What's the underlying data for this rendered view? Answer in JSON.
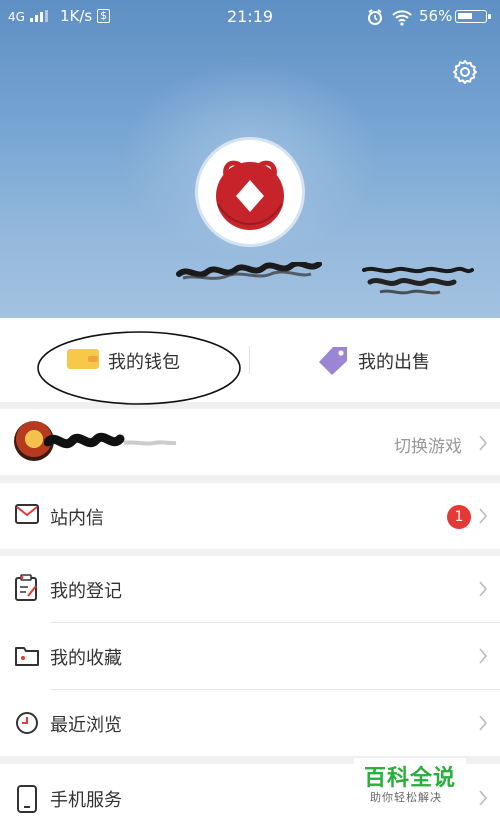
{
  "status_bar": {
    "network": "4G",
    "speed": "1K/s",
    "speed_icon": "$",
    "time": "21:19",
    "battery": "56%",
    "battery_level": 0.56
  },
  "header": {
    "settings_icon": "gear-icon",
    "avatar_icon": "red-lucky-bag-icon"
  },
  "wallet_bar": {
    "wallet_label": "我的钱包",
    "sale_label": "我的出售"
  },
  "game_row": {
    "switch_label": "切换游戏"
  },
  "menu": {
    "inbox_label": "站内信",
    "inbox_badge": "1",
    "register_label": "我的登记",
    "favorites_label": "我的收藏",
    "recent_label": "最近浏览",
    "phone_service_label": "手机服务"
  },
  "watermark": {
    "title": "百科全说",
    "subtitle": "助你轻松解决"
  },
  "colors": {
    "accent_green": "#27ae3b",
    "badge_red": "#e53935",
    "wallet_yellow": "#f7c94a",
    "sale_purple": "#9b86d6"
  }
}
